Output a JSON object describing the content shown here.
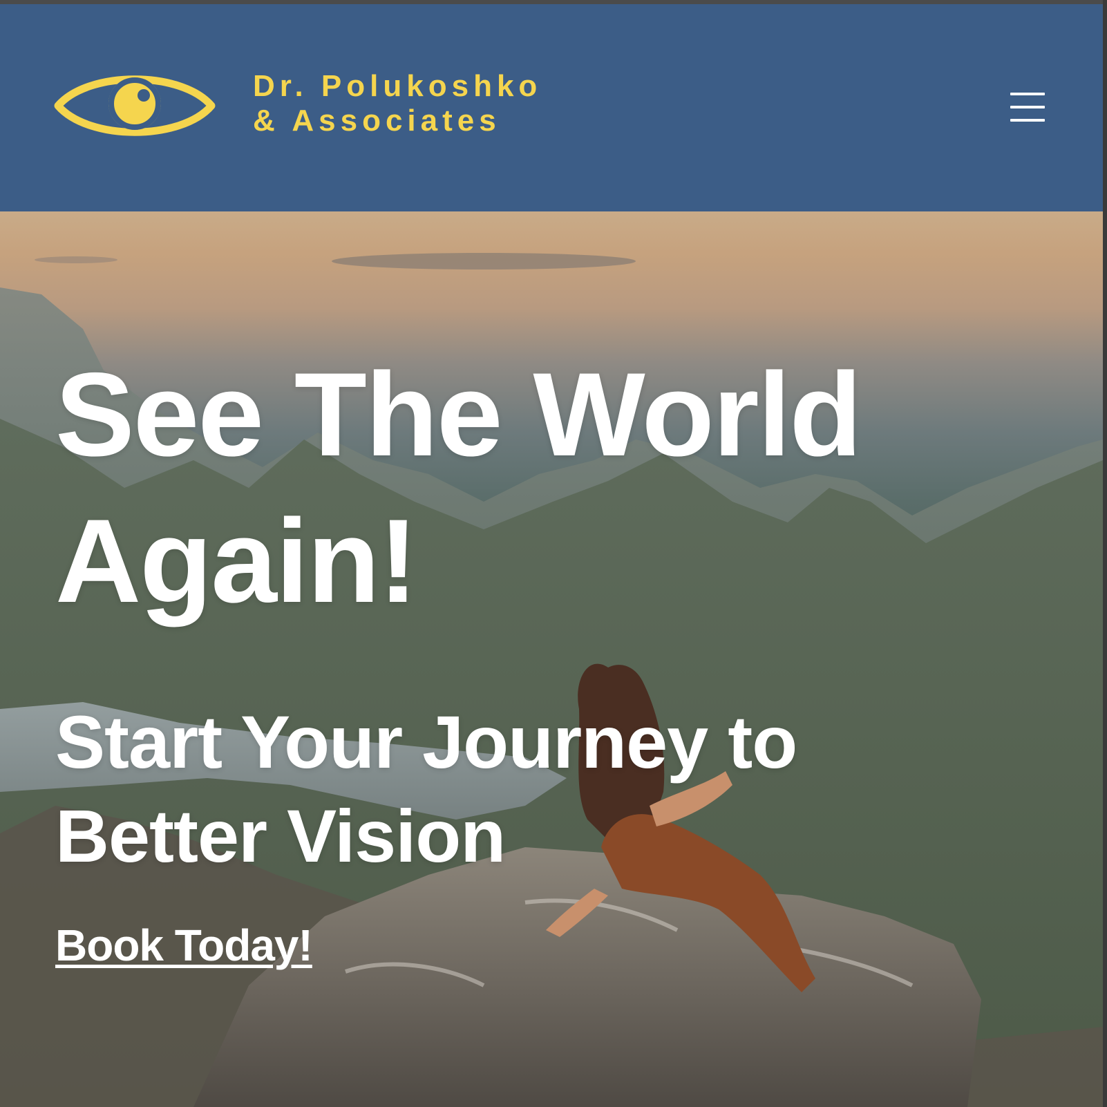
{
  "header": {
    "brand_line1": "Dr. Polukoshko",
    "brand_line2": "& Associates",
    "logo_icon": "eye-icon",
    "menu_icon": "hamburger-menu-icon"
  },
  "hero": {
    "headline": "See The World Again!",
    "subheadline": "Start Your Journey to Better Vision",
    "cta_label": "Book Today!",
    "background": "mountain-landscape-photo"
  },
  "colors": {
    "header_bg": "#3c5d87",
    "brand_yellow": "#f5d54e",
    "hero_text": "#ffffff"
  }
}
